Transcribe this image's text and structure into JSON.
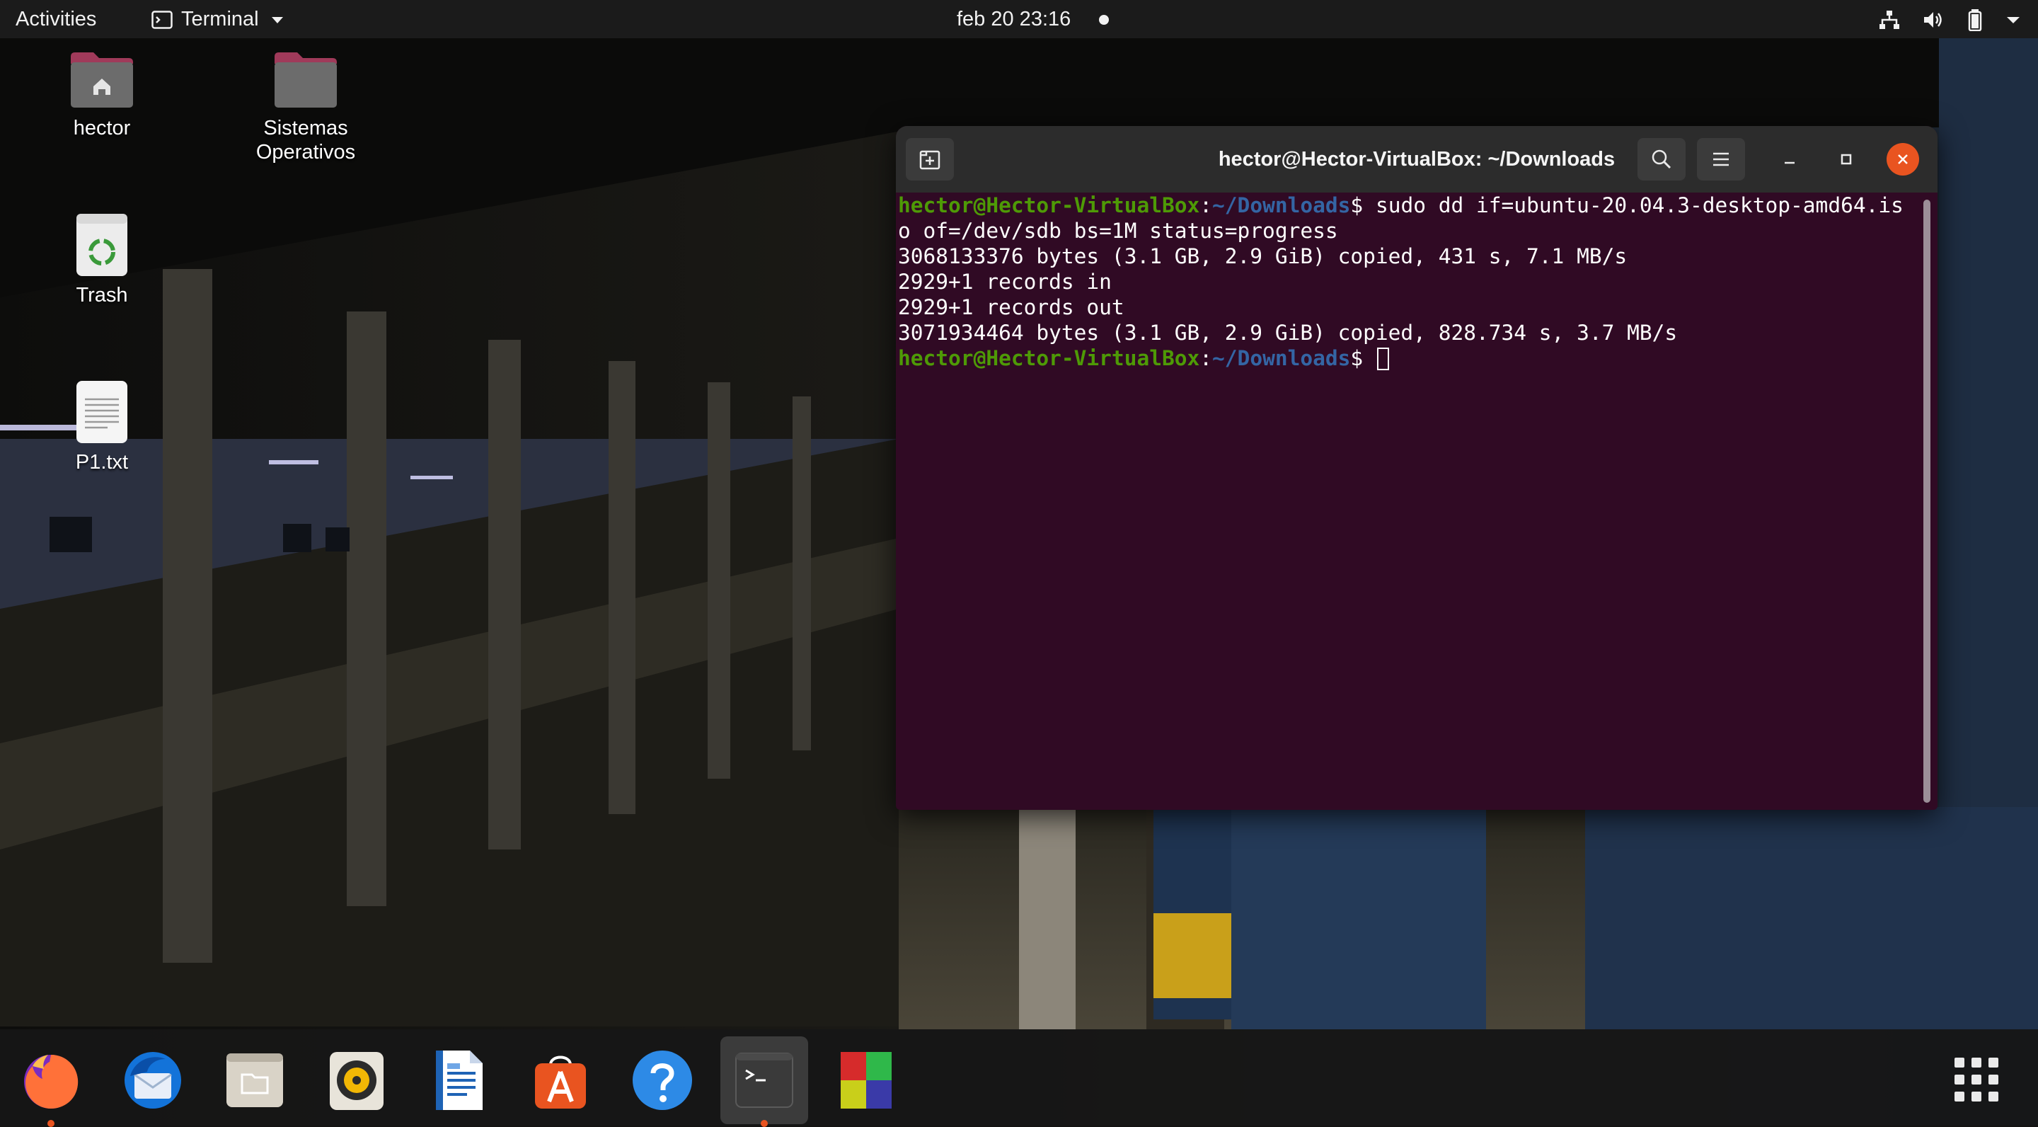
{
  "topbar": {
    "activities": "Activities",
    "app_menu": "Terminal",
    "clock": "feb 20  23:16",
    "tray_icons": [
      "network-wired-icon",
      "volume-icon",
      "battery-icon",
      "system-menu-chevron-icon"
    ]
  },
  "desktop": {
    "icons": [
      {
        "name": "home-folder",
        "label": "hector"
      },
      {
        "name": "folder",
        "label_line1": "Sistemas",
        "label_line2": "Operativos"
      },
      {
        "name": "trash",
        "label": "Trash"
      },
      {
        "name": "text-file",
        "label": "P1.txt"
      }
    ]
  },
  "terminal": {
    "title": "hector@Hector-VirtualBox: ~/Downloads",
    "prompt_user": "hector@Hector-VirtualBox",
    "prompt_sep": ":",
    "prompt_path": "~/Downloads",
    "prompt_symbol": "$ ",
    "command_line1": "sudo dd if=ubuntu-20.04.3-desktop-amd64.is",
    "command_line2": "o of=/dev/sdb bs=1M status=progress",
    "output": [
      "3068133376 bytes (3.1 GB, 2.9 GiB) copied, 431 s, 7.1 MB/s",
      "2929+1 records in",
      "2929+1 records out",
      "3071934464 bytes (3.1 GB, 2.9 GiB) copied, 828.734 s, 3.7 MB/s"
    ],
    "colors": {
      "background": "#300a24",
      "header": "#2c2c2c",
      "prompt_user": "#4e9a06",
      "prompt_path": "#3465a4",
      "close": "#e95420"
    }
  },
  "dock": {
    "apps": [
      "firefox-icon",
      "thunderbird-icon",
      "files-icon",
      "rhythmbox-icon",
      "libreoffice-writer-icon",
      "ubuntu-software-icon",
      "help-icon",
      "terminal-icon",
      "virtualbox-icon"
    ],
    "running": [
      "firefox-icon",
      "terminal-icon"
    ],
    "show_apps": "show-applications-icon"
  }
}
